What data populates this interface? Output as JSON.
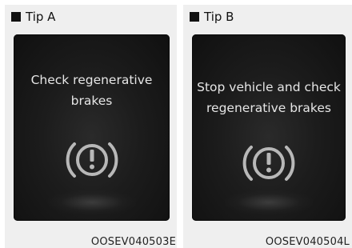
{
  "panels": [
    {
      "tip_label": "Tip A",
      "message_line1": "Check regenerative",
      "message_line2": "brakes",
      "icon": "brake-warning-icon",
      "code": "OOSEV040503E"
    },
    {
      "tip_label": "Tip B",
      "message_line1": "Stop vehicle and check",
      "message_line2": "regenerative brakes",
      "icon": "brake-warning-icon",
      "code": "OOSEV040504L"
    }
  ],
  "colors": {
    "panel_bg": "#efefef",
    "screen_bg": "#1c1c1c",
    "screen_text": "#e6e6e6",
    "icon_stroke": "#b8b8b8"
  }
}
